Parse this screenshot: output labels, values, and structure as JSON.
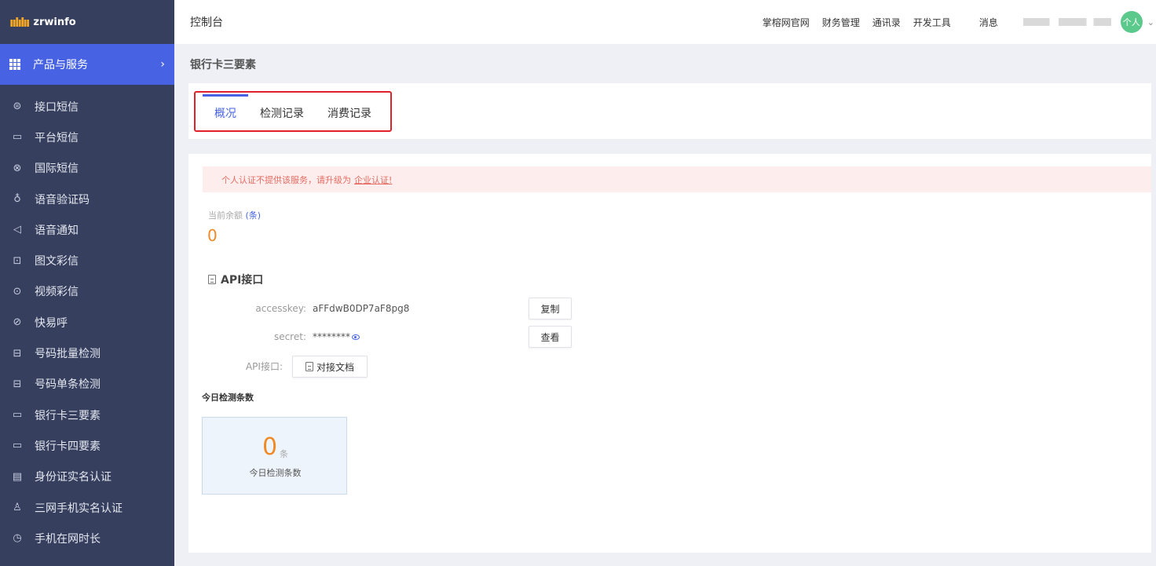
{
  "logo": {
    "mark": "ıılılıı",
    "text": "zrwinfo"
  },
  "sidebar": {
    "group": {
      "label": "产品与服务",
      "chevron": "›"
    },
    "items": [
      {
        "label": "接口短信",
        "icon": "chat-bubble-icon",
        "glyph": "⊜"
      },
      {
        "label": "平台短信",
        "icon": "message-icon",
        "glyph": "▭"
      },
      {
        "label": "国际短信",
        "icon": "globe-icon",
        "glyph": "⊗"
      },
      {
        "label": "语音验证码",
        "icon": "microphone-icon",
        "glyph": "♁"
      },
      {
        "label": "语音通知",
        "icon": "speaker-icon",
        "glyph": "◁"
      },
      {
        "label": "图文彩信",
        "icon": "image-icon",
        "glyph": "⊡"
      },
      {
        "label": "视频彩信",
        "icon": "play-icon",
        "glyph": "⊙"
      },
      {
        "label": "快易呼",
        "icon": "call-icon",
        "glyph": "⊘"
      },
      {
        "label": "号码批量检测",
        "icon": "scan-icon",
        "glyph": "⊟"
      },
      {
        "label": "号码单条检测",
        "icon": "scan-icon",
        "glyph": "⊟"
      },
      {
        "label": "银行卡三要素",
        "icon": "card-icon",
        "glyph": "▭"
      },
      {
        "label": "银行卡四要素",
        "icon": "card-icon",
        "glyph": "▭"
      },
      {
        "label": "身份证实名认证",
        "icon": "id-card-icon",
        "glyph": "▤"
      },
      {
        "label": "三网手机实名认证",
        "icon": "user-icon",
        "glyph": "♙"
      },
      {
        "label": "手机在网时长",
        "icon": "clock-icon",
        "glyph": "◷"
      }
    ]
  },
  "header": {
    "title": "控制台",
    "nav": [
      "掌榕网官网",
      "财务管理",
      "通讯录",
      "开发工具"
    ],
    "message": "消息",
    "avatar": "个人",
    "avatar_chevron": "⌄"
  },
  "page": {
    "title": "银行卡三要素"
  },
  "tabs": [
    {
      "label": "概况",
      "active": true
    },
    {
      "label": "检测记录",
      "active": false
    },
    {
      "label": "消费记录",
      "active": false
    }
  ],
  "alert": {
    "text": "个人认证不提供该服务，请升级为",
    "link": "企业认证!"
  },
  "balance": {
    "label": "当前余额",
    "unit": "(条)",
    "value": "0"
  },
  "api": {
    "title": "API接口",
    "accesskey_label": "accesskey:",
    "accesskey_value": "aFFdwB0DP7aF8pg8",
    "copy_button": "复制",
    "secret_label": "secret:",
    "secret_value": "********",
    "view_button": "查看",
    "api_label": "API接口:",
    "doc_button": "对接文档"
  },
  "today": {
    "section_label": "今日检测条数",
    "value": "0",
    "unit": "条",
    "caption": "今日检测条数"
  },
  "colors": {
    "sidebar_bg": "#363f5e",
    "accent": "#4763e4",
    "highlight_border": "#e0202a",
    "value_orange": "#f08a24",
    "alert_text": "#e66b63"
  }
}
